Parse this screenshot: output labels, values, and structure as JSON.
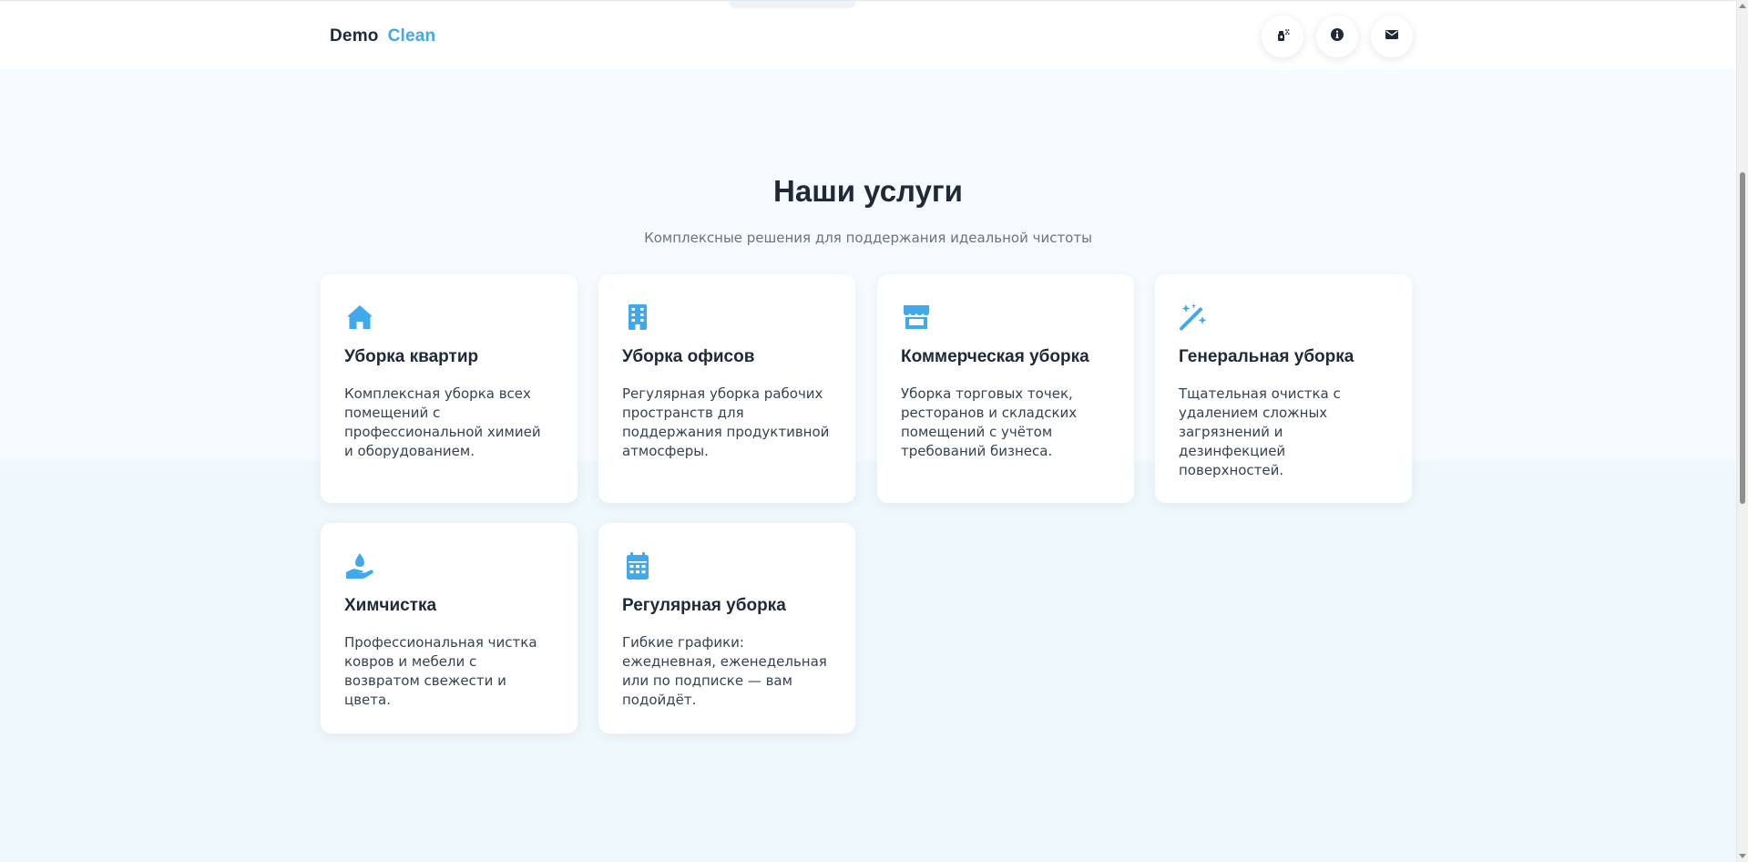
{
  "header": {
    "brand_primary": "Demo",
    "brand_accent": "Clean",
    "buttons": [
      {
        "icon": "spray-bottle-icon"
      },
      {
        "icon": "info-icon"
      },
      {
        "icon": "envelope-icon"
      }
    ]
  },
  "section": {
    "title": "Наши услуги",
    "subtitle": "Комплексные решения для поддержания идеальной чистоты"
  },
  "services": [
    {
      "icon": "house-icon",
      "title": "Уборка квартир",
      "description": "Комплексная уборка всех помещений с профессиональной химией и оборудованием."
    },
    {
      "icon": "building-icon",
      "title": "Уборка офисов",
      "description": "Регулярная уборка рабочих пространств для поддержания продуктивной атмосферы."
    },
    {
      "icon": "store-icon",
      "title": "Коммерческая уборка",
      "description": "Уборка торговых точек, ресторанов и складских помещений с учётом требований бизнеса."
    },
    {
      "icon": "magic-wand-icon",
      "title": "Генеральная уборка",
      "description": "Тщательная очистка с удалением сложных загрязнений и дезинфекцией поверхностей."
    },
    {
      "icon": "hand-droplet-icon",
      "title": "Химчистка",
      "description": "Профессиональная чистка ковров и мебели с возвратом свежести и цвета."
    },
    {
      "icon": "calendar-icon",
      "title": "Регулярная уборка",
      "description": "Гибкие графики: ежедневная, еженедельная или по подписке — вам подойдёт."
    }
  ],
  "colors": {
    "accent": "#3fa9ec",
    "text_dark": "#1f2937",
    "text_muted": "#6b7280",
    "background": "#f3fafd"
  }
}
